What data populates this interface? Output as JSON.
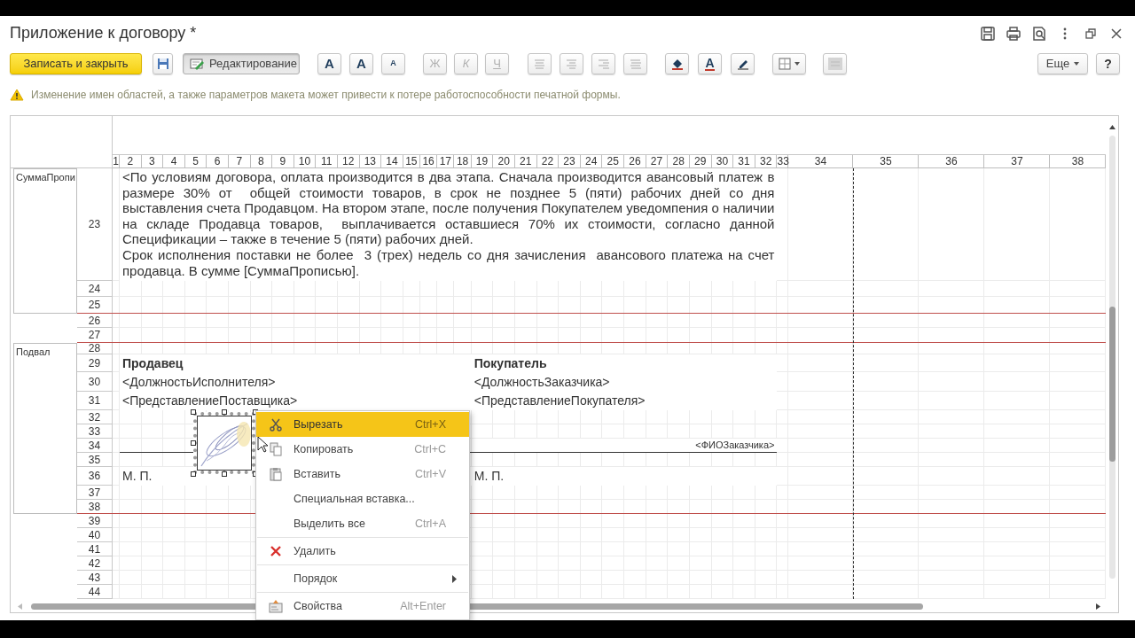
{
  "window": {
    "title": "Приложение к договору *"
  },
  "toolbar": {
    "save_close": "Записать и закрыть",
    "edit_mode": {
      "label": "Редактирование",
      "pressed": true
    },
    "font_buttons": [
      {
        "label": "A",
        "kind": "normal"
      },
      {
        "label": "A",
        "kind": "larger"
      },
      {
        "label": "A",
        "kind": "smaller"
      }
    ],
    "style_buttons": [
      {
        "label": "Ж",
        "kind": "bold",
        "disabled": true
      },
      {
        "label": "К",
        "kind": "italic",
        "disabled": true
      },
      {
        "label": "Ч",
        "kind": "underline",
        "disabled": true
      }
    ],
    "font_color_button": {
      "label": "A"
    },
    "more": "Еще",
    "help": "?"
  },
  "warning": "Изменение имен областей, а также параметров макета может привести к потере работоспособности печатной формы.",
  "sheet": {
    "columns": [
      "1",
      "2",
      "3",
      "4",
      "5",
      "6",
      "7",
      "8",
      "9",
      "10",
      "11",
      "12",
      "13",
      "14",
      "15",
      "16",
      "17",
      "18",
      "19",
      "20",
      "21",
      "22",
      "23",
      "24",
      "25",
      "26",
      "27",
      "28",
      "29",
      "30",
      "31",
      "32",
      "33",
      "34",
      "35",
      "36",
      "37",
      "38"
    ],
    "rows": [
      "23",
      "24",
      "25",
      "26",
      "27",
      "28",
      "29",
      "30",
      "31",
      "32",
      "33",
      "34",
      "35",
      "36",
      "37",
      "38",
      "39",
      "40",
      "41",
      "42",
      "43",
      "44"
    ],
    "areas": [
      {
        "name": "СуммаПропи"
      },
      {
        "name": "Подвал"
      }
    ],
    "payment_terms": [
      "<По условиям договора, оплата производится в два этапа. Сначала производится авансовый платеж в размере 30% от  общей стоимости товаров, в срок не позднее 5 (пяти) рабочих дней со дня выставления счета Продавцом. На втором этапе, после получения Покупателем уведомпения о наличии на складе Продавца товаров,  выплачивается оставшиеся 70% их стоимости, согласно данной Спецификации – также в течение 5 (пяти) рабочих дней.",
      "Срок исполнения поставки не более  3 (трех) недель со дня зачисления  авансового платежа на счет продавца. В сумме [СуммаПрописью]."
    ],
    "seller": {
      "title": "Продавец",
      "position": "<ДолжностьИсполнителя>",
      "name": "<ПредставлениеПоставщика>",
      "stamp": "М. П."
    },
    "buyer": {
      "title": "Покупатель",
      "position": "<ДолжностьЗаказчика>",
      "name": "<ПредставлениеПокупателя>",
      "signatory": "<ФИОЗаказчика>",
      "stamp": "М. П."
    }
  },
  "context_menu": [
    {
      "label": "Вырезать",
      "shortcut": "Ctrl+X",
      "kind": "cut",
      "highlighted": true
    },
    {
      "label": "Копировать",
      "shortcut": "Ctrl+C",
      "kind": "copy",
      "highlighted": false
    },
    {
      "label": "Вставить",
      "shortcut": "Ctrl+V",
      "kind": "paste",
      "highlighted": false
    },
    {
      "label": "Специальная вставка...",
      "kind": "text",
      "highlighted": false
    },
    {
      "label": "Выделить все",
      "shortcut": "Ctrl+A",
      "kind": "text",
      "highlighted": false
    },
    {
      "label": "Удалить",
      "kind": "delete",
      "highlighted": false,
      "separator_before": true
    },
    {
      "label": "Порядок",
      "kind": "text",
      "highlighted": false,
      "separator_before": true,
      "submenu": true
    },
    {
      "label": "Свойства",
      "shortcut": "Alt+Enter",
      "kind": "properties",
      "highlighted": false,
      "separator_before": true
    }
  ]
}
